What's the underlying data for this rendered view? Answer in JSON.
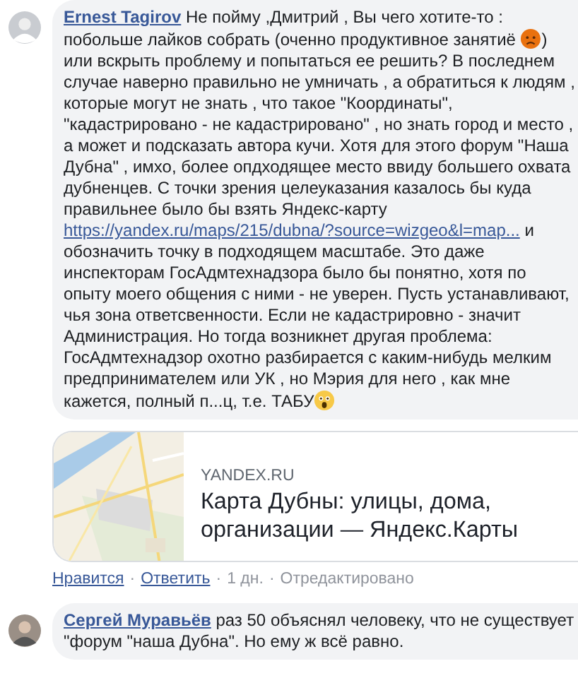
{
  "comments": [
    {
      "author": "Ernest Tagirov",
      "body": [
        {
          "kind": "text",
          "text": "Не пойму ,Дмитрий , Вы чего хотите-то : побольше лайков собрать (оченно продуктивное занятиё "
        },
        {
          "kind": "angry"
        },
        {
          "kind": "text",
          "text": ") или вскрыть проблему и попытаться ее решить? В последнем случае наверно правильно не умничать , а обратиться к людям , которые могут не знать , что такое \"Координаты\", \"кадастрировано - не кадастрировано\" , но знать город и место , а может и подсказать автора кучи. Хотя для этого форум \"Наша Дубна\" , имхо, более опдходящее место ввиду большего охвата дубненцев. С точки зрения целеуказания казалось бы куда правильнее было бы взять Яндекс-карту "
        },
        {
          "kind": "link",
          "text": "https://yandex.ru/maps/215/dubna/?source=wizgeo&l=map..."
        },
        {
          "kind": "text",
          "text": " и обозначить точку в подходящем масштабе. Это даже инспекторам ГосАдмтехнадзора было бы понятно, хотя по опыту моего общения с ними - не уверен. Пусть устанавливают, чья зона ответсвенности. Если не кадастрировно - значит Администрация. Но тогда возникнет другая проблема: ГосАдмтехнадзор охотно разбирается с каким-нибудь мелким предпринимателем или УК , но Мэрия для него , как мне кажется, полный п...ц, т.е. ТАБУ"
        },
        {
          "kind": "shocked"
        }
      ],
      "preview": {
        "domain": "YANDEX.RU",
        "title": "Карта Дубны: улицы, дома, организации — Яндекс.Карты"
      },
      "actions": [
        {
          "kind": "link",
          "text": "Нравится"
        },
        {
          "kind": "dot",
          "text": "·"
        },
        {
          "kind": "link",
          "text": "Ответить"
        },
        {
          "kind": "dot",
          "text": "·"
        },
        {
          "kind": "time",
          "text": "1 дн."
        },
        {
          "kind": "dot",
          "text": "·"
        },
        {
          "kind": "note",
          "text": "Отредактировано"
        }
      ]
    },
    {
      "author": "Сергей Муравьёв",
      "body": [
        {
          "kind": "text",
          "text": "раз 50 объяснял человеку, что не существует \"форум \"наша Дубна\". Но ему ж всё равно."
        }
      ]
    }
  ]
}
